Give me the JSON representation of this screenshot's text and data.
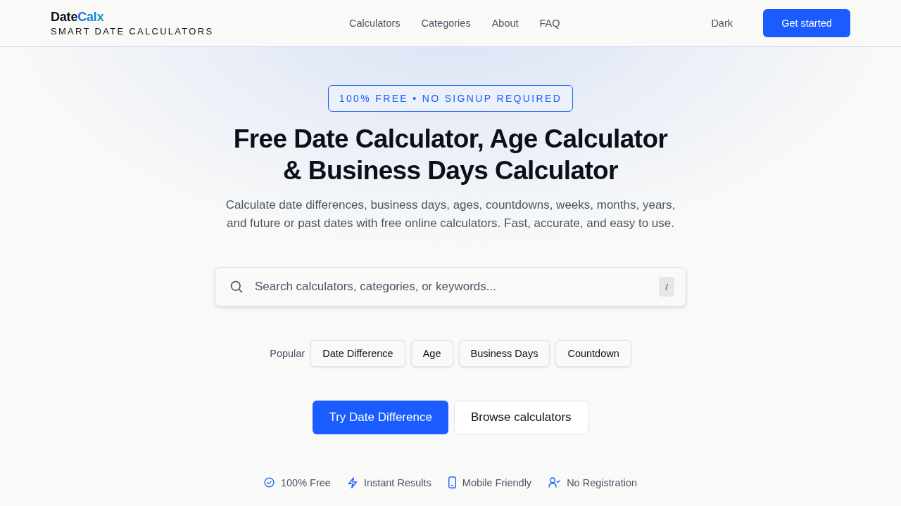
{
  "header": {
    "logo": {
      "part_1": "Date",
      "part_2": "Calx"
    },
    "tagline": "SMART DATE CALCULATORS",
    "nav": [
      "Calculators",
      "Categories",
      "About",
      "FAQ"
    ],
    "theme_toggle": "Dark",
    "cta": "Get started"
  },
  "hero": {
    "badge": "100% FREE • NO SIGNUP REQUIRED",
    "title_lines": [
      "Free Date Calculator, Age Calculator",
      "& Business Days Calculator"
    ],
    "subtitle": "Calculate date differences, business days, ages, countdowns, weeks, months, years, and future or past dates with free online calculators. Fast, accurate, and easy to use.",
    "search": {
      "placeholder": "Search calculators, categories, or keywords...",
      "shortcut": "/"
    },
    "popular": {
      "label": "Popular",
      "chips": [
        "Date Difference",
        "Age",
        "Business Days",
        "Countdown"
      ]
    },
    "buttons": [
      {
        "label": "Try Date Difference",
        "kind": "primary"
      },
      {
        "label": "Browse calculators",
        "kind": "secondary"
      }
    ],
    "features": [
      {
        "kind": "check",
        "label": "100% Free"
      },
      {
        "kind": "bolt",
        "label": "Instant Results"
      },
      {
        "kind": "phone",
        "label": "Mobile Friendly"
      },
      {
        "kind": "user-check",
        "label": "No Registration"
      }
    ]
  }
}
